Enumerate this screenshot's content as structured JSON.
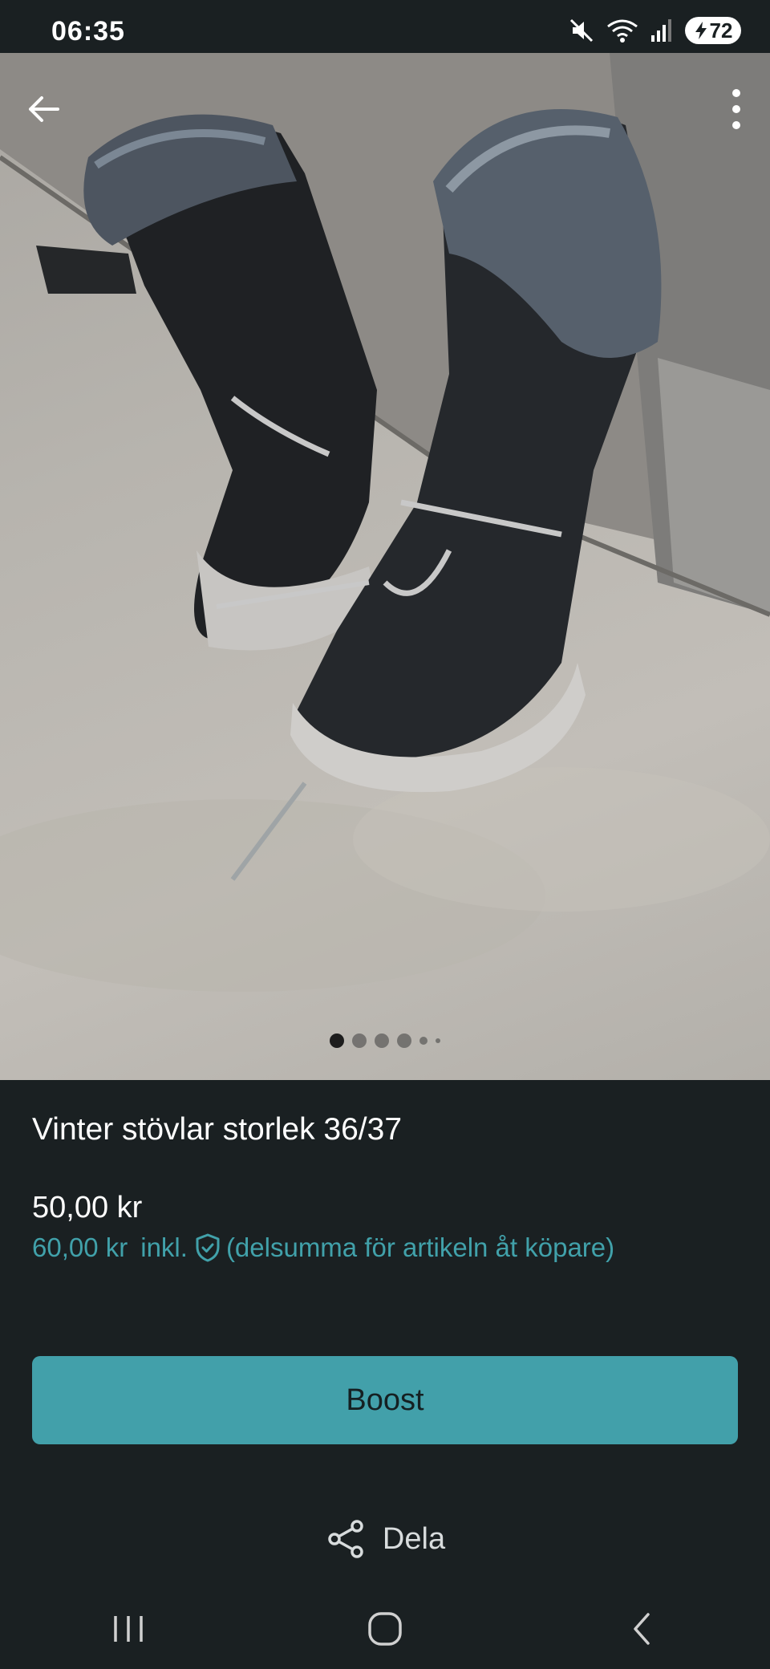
{
  "status_bar": {
    "time": "06:35",
    "battery": "72",
    "icons": [
      "mute-icon",
      "wifi-icon",
      "signal-icon",
      "battery-icon"
    ]
  },
  "gallery": {
    "image_alt": "Vinter stövlar storlek 36/37",
    "page_count": 5,
    "current_page": 1
  },
  "listing": {
    "title": "Vinter stövlar storlek 36/37",
    "price": "50,00 kr",
    "price_incl_amount": "60,00 kr",
    "price_incl_label": "inkl.",
    "price_incl_note": "(delsumma för artikeln åt köpare)"
  },
  "actions": {
    "boost_label": "Boost",
    "share_label": "Dela"
  },
  "colors": {
    "background": "#1a2022",
    "accent": "#42a0aa",
    "accent_text": "#41a1aa"
  }
}
